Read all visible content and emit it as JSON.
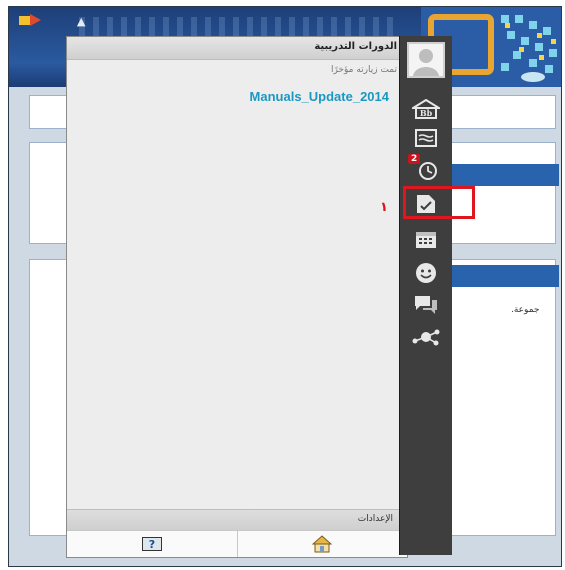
{
  "panel": {
    "title": "الدورات التدريبية",
    "subtitle": "تمت زيارته مؤخرًا",
    "course_link": "Manuals_Update_2014",
    "annotation": "١",
    "settings_label": "الإعدادات"
  },
  "sidebar": {
    "notification_count": "2",
    "items": [
      "avatar",
      "blackboard-home-icon",
      "stream-icon",
      "due-dates-icon",
      "grades-icon",
      "calendar-icon",
      "people-icon",
      "messages-icon",
      "network-icon"
    ]
  },
  "background": {
    "partial_text": "جموعة."
  },
  "colors": {
    "sidebar": "#3e3e3e",
    "link": "#1a98c4",
    "highlight": "#e0161e",
    "header_blue": "#2a63ad"
  }
}
